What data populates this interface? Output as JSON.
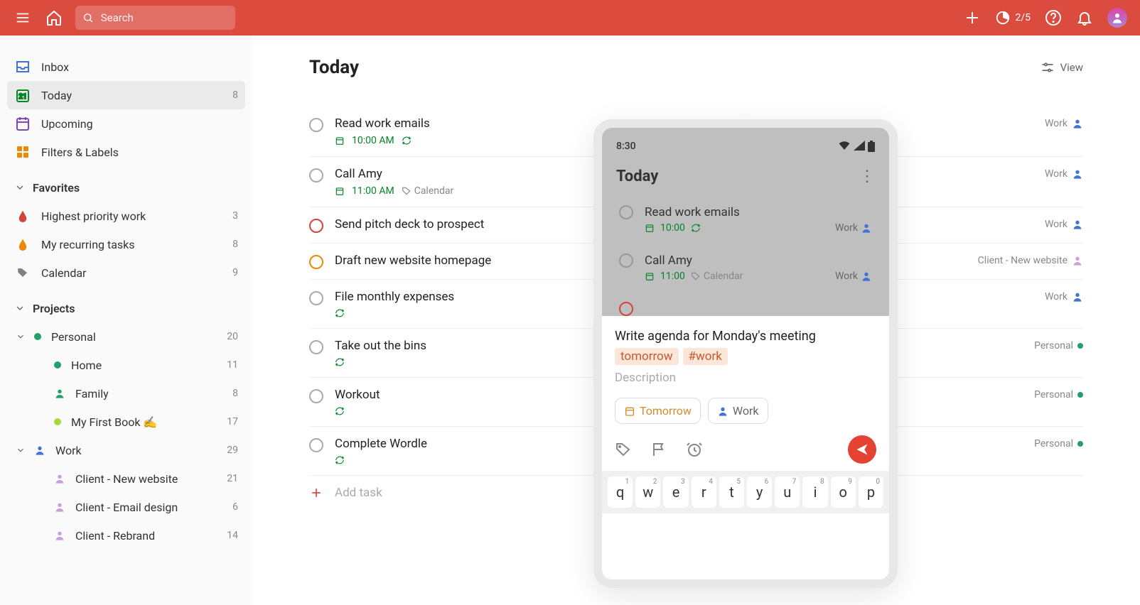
{
  "topbar": {
    "search_placeholder": "Search",
    "progress": "2/5"
  },
  "sidebar": {
    "inbox": "Inbox",
    "today": "Today",
    "today_count": "8",
    "upcoming": "Upcoming",
    "filters_labels": "Filters & Labels",
    "favorites_header": "Favorites",
    "favorites": [
      {
        "label": "Highest priority work",
        "count": "3",
        "color": "#d1453b",
        "icon": "drop"
      },
      {
        "label": "My recurring tasks",
        "count": "8",
        "color": "#eb8909",
        "icon": "drop"
      },
      {
        "label": "Calendar",
        "count": "9",
        "color": "#808080",
        "icon": "tag"
      }
    ],
    "projects_header": "Projects",
    "projects": [
      {
        "label": "Personal",
        "count": "20",
        "color": "#22a06b",
        "expandable": true,
        "expanded": true,
        "children": [
          {
            "label": "Home",
            "count": "11",
            "color": "#22a06b",
            "type": "dot"
          },
          {
            "label": "Family",
            "count": "8",
            "color": "#22a06b",
            "type": "person"
          },
          {
            "label": "My First Book ✍️",
            "count": "17",
            "color": "#a5d936",
            "type": "dot"
          }
        ]
      },
      {
        "label": "Work",
        "count": "29",
        "color": "#4073d6",
        "expandable": true,
        "expanded": true,
        "type": "person",
        "children": [
          {
            "label": "Client - New website",
            "count": "21",
            "color": "#c9a0dc",
            "type": "person"
          },
          {
            "label": "Client - Email design",
            "count": "6",
            "color": "#c9a0dc",
            "type": "person"
          },
          {
            "label": "Client - Rebrand",
            "count": "14",
            "color": "#c9a0dc",
            "type": "person"
          }
        ]
      }
    ]
  },
  "content": {
    "title": "Today",
    "view_label": "View",
    "tasks": [
      {
        "title": "Read work emails",
        "time": "10:00 AM",
        "recurring": true,
        "priority": "",
        "project": "Work",
        "proj_icon": "person",
        "proj_color": "#4073d6"
      },
      {
        "title": "Call Amy",
        "time": "11:00 AM",
        "recurring": false,
        "label": "Calendar",
        "priority": "",
        "project": "Work",
        "proj_icon": "person",
        "proj_color": "#4073d6"
      },
      {
        "title": "Send pitch deck to prospect",
        "priority": "pri1",
        "project": "Work",
        "proj_icon": "person",
        "proj_color": "#4073d6"
      },
      {
        "title": "Draft new website homepage",
        "priority": "pri2",
        "project": "Client - New website",
        "proj_icon": "person",
        "proj_color": "#c9a0dc"
      },
      {
        "title": "File monthly expenses",
        "recurring": true,
        "project": "Work",
        "proj_icon": "person",
        "proj_color": "#4073d6"
      },
      {
        "title": "Take out the bins",
        "recurring": true,
        "project": "Personal",
        "proj_icon": "dot",
        "proj_color": "#22a06b"
      },
      {
        "title": "Workout",
        "recurring": true,
        "project": "Personal",
        "proj_icon": "dot",
        "proj_color": "#22a06b"
      },
      {
        "title": "Complete Wordle",
        "recurring": true,
        "project": "Personal",
        "proj_icon": "dot",
        "proj_color": "#22a06b"
      }
    ],
    "add_task": "Add task"
  },
  "phone": {
    "time": "8:30",
    "title": "Today",
    "tasks": [
      {
        "title": "Read work emails",
        "time": "10:00",
        "recurring": true,
        "proj": "Work"
      },
      {
        "title": "Call Amy",
        "time": "11:00",
        "label": "Calendar",
        "proj": "Work"
      }
    ],
    "compose": {
      "text": "Write agenda for Monday's meeting",
      "date_chip": "tomorrow",
      "tag_chip": "#work",
      "desc_placeholder": "Description",
      "pill_tomorrow": "Tomorrow",
      "pill_work": "Work"
    },
    "keyboard": [
      {
        "c": "q",
        "n": "1"
      },
      {
        "c": "w",
        "n": "2"
      },
      {
        "c": "e",
        "n": "3"
      },
      {
        "c": "r",
        "n": "4"
      },
      {
        "c": "t",
        "n": "5"
      },
      {
        "c": "y",
        "n": "6"
      },
      {
        "c": "u",
        "n": "7"
      },
      {
        "c": "i",
        "n": "8"
      },
      {
        "c": "o",
        "n": "9"
      },
      {
        "c": "p",
        "n": "0"
      }
    ]
  }
}
